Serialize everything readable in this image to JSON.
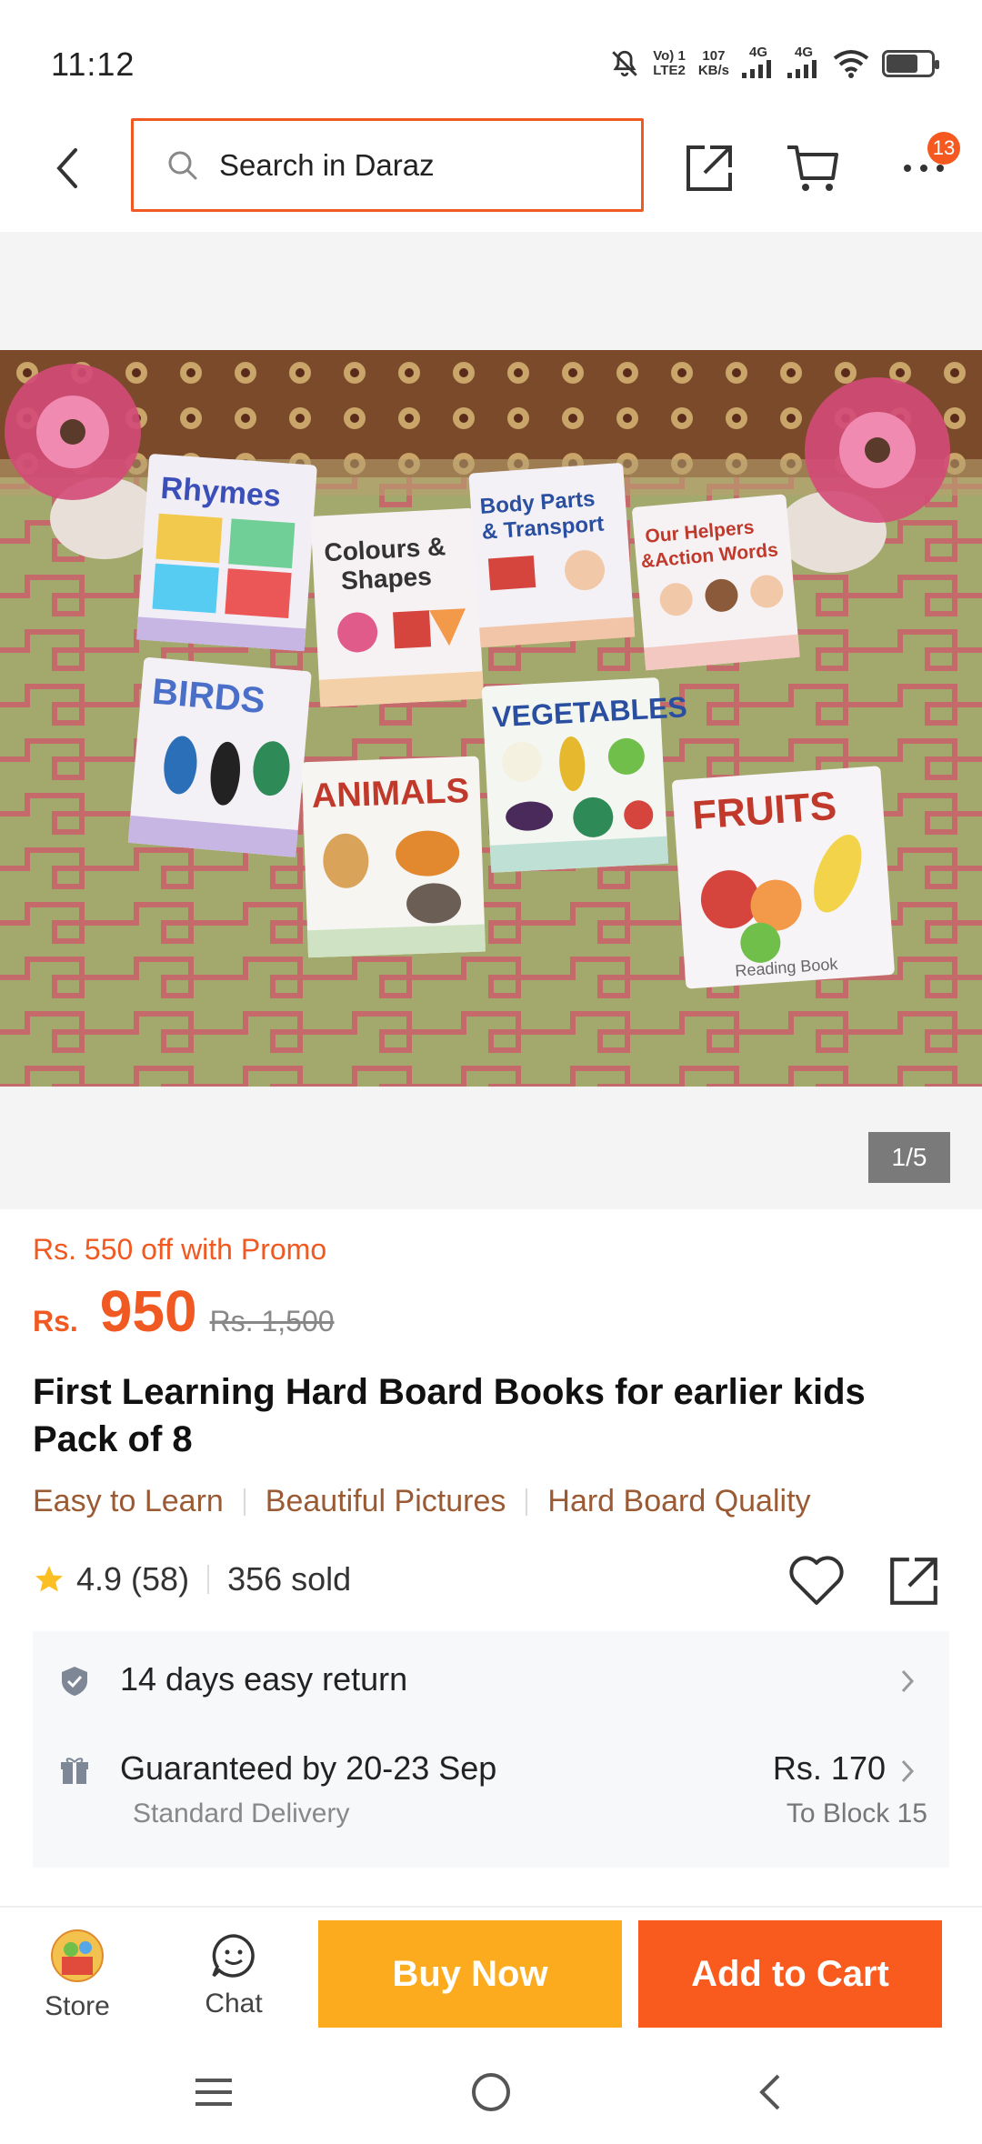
{
  "status_bar": {
    "time": "11:12",
    "volte_line1": "Vo) 1",
    "volte_line2": "LTE2",
    "speed_value": "107",
    "speed_unit": "KB/s",
    "net1": "4G",
    "net2": "4G",
    "battery_level": 0.7
  },
  "header": {
    "search_placeholder": "Search in Daraz",
    "more_badge": "13"
  },
  "gallery": {
    "counter": "1/5",
    "books": [
      {
        "title": "Rhymes"
      },
      {
        "title": "Colours & Shapes"
      },
      {
        "title": "Body Parts & Transport"
      },
      {
        "title": "Our Helpers & Action Words"
      },
      {
        "title": "BIRDS"
      },
      {
        "title": "ANIMALS"
      },
      {
        "title": "VEGETABLES"
      },
      {
        "title": "FRUITS"
      }
    ],
    "book_subtitle": "Reading Book"
  },
  "product": {
    "promo": "Rs. 550 off with Promo",
    "currency": "Rs.",
    "price": "950",
    "original_price": "Rs. 1,500",
    "title": "First Learning Hard Board Books for earlier kids Pack of 8",
    "tags": [
      "Easy to Learn",
      "Beautiful Pictures",
      "Hard Board Quality"
    ],
    "rating": "4.9",
    "rating_count": "(58)",
    "sold": "356 sold"
  },
  "service": {
    "return_text": "14 days easy return",
    "delivery_text": "Guaranteed by 20-23 Sep",
    "delivery_type": "Standard Delivery",
    "delivery_fee": "Rs. 170",
    "delivery_to": "To Block 15"
  },
  "action_bar": {
    "store_label": "Store",
    "chat_label": "Chat",
    "buy_now": "Buy Now",
    "add_to_cart": "Add to Cart"
  },
  "colors": {
    "brand": "#f05a22",
    "buy_now": "#fcab1f",
    "add_to_cart": "#f85b1d",
    "tag_text": "#9a5a33"
  }
}
